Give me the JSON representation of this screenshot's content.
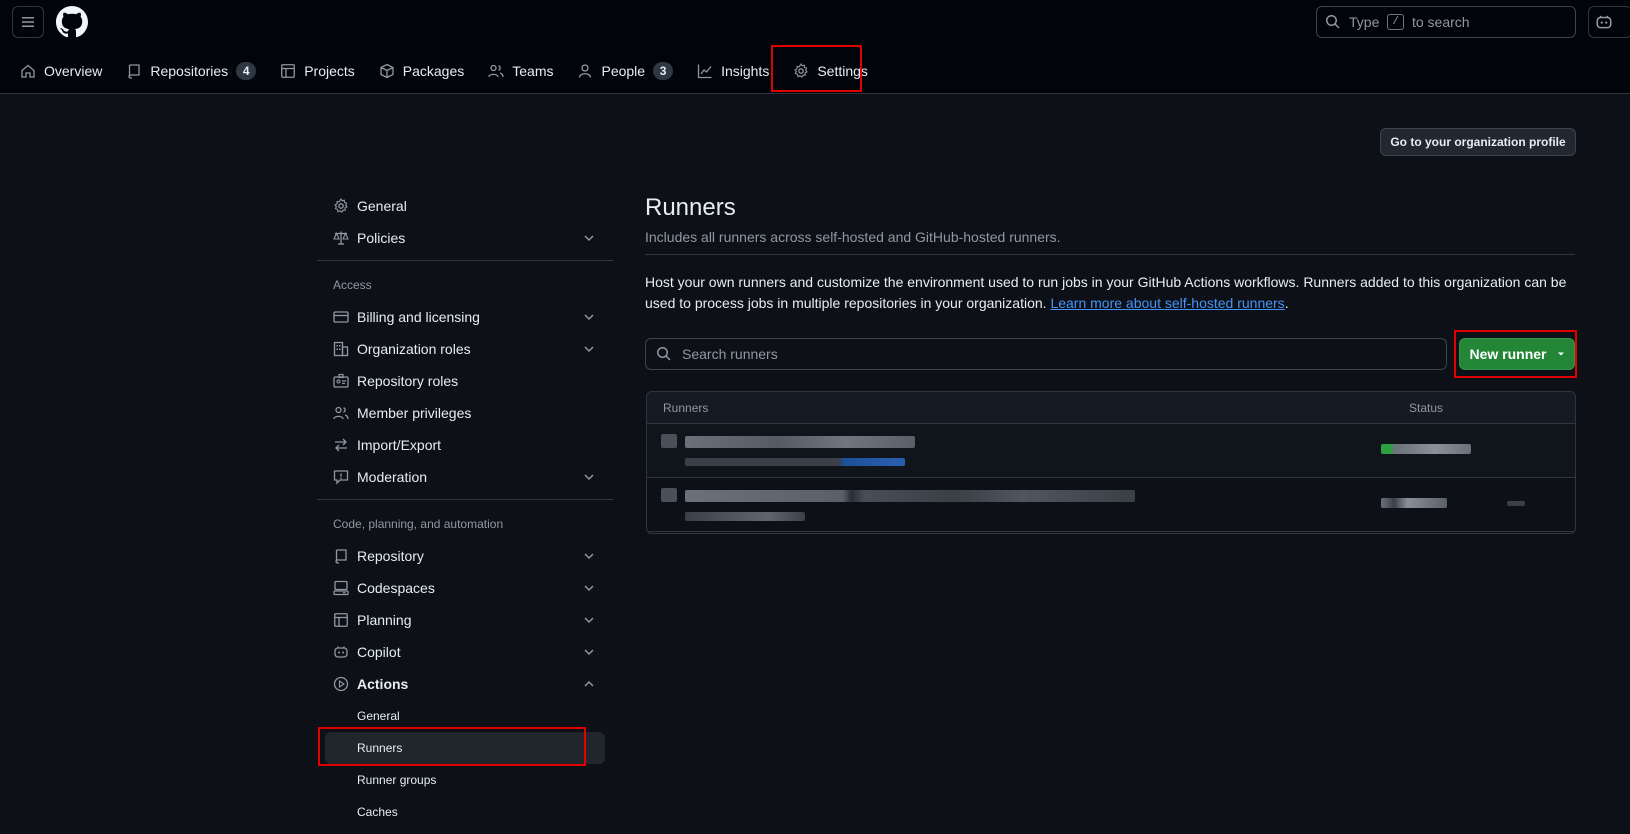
{
  "header": {
    "search_prefix": "Type",
    "search_key": "/",
    "search_suffix": "to search"
  },
  "orgnav": {
    "tabs": [
      {
        "label": "Overview"
      },
      {
        "label": "Repositories",
        "count": "4"
      },
      {
        "label": "Projects"
      },
      {
        "label": "Packages"
      },
      {
        "label": "Teams"
      },
      {
        "label": "People",
        "count": "3"
      },
      {
        "label": "Insights"
      },
      {
        "label": "Settings"
      }
    ]
  },
  "sidebar": {
    "top": [
      {
        "label": "General"
      },
      {
        "label": "Policies"
      }
    ],
    "access_heading": "Access",
    "access": [
      {
        "label": "Billing and licensing"
      },
      {
        "label": "Organization roles"
      },
      {
        "label": "Repository roles"
      },
      {
        "label": "Member privileges"
      },
      {
        "label": "Import/Export"
      },
      {
        "label": "Moderation"
      }
    ],
    "code_heading": "Code, planning, and automation",
    "code": [
      {
        "label": "Repository"
      },
      {
        "label": "Codespaces"
      },
      {
        "label": "Planning"
      },
      {
        "label": "Copilot"
      },
      {
        "label": "Actions"
      }
    ],
    "actions_sub": [
      {
        "label": "General"
      },
      {
        "label": "Runners"
      },
      {
        "label": "Runner groups"
      },
      {
        "label": "Caches"
      }
    ]
  },
  "main": {
    "profile_button": "Go to your organization profile",
    "title": "Runners",
    "subtitle": "Includes all runners across self-hosted and GitHub-hosted runners.",
    "description": "Host your own runners and customize the environment used to run jobs in your GitHub Actions workflows. Runners added to this organization can be used to process jobs in multiple repositories in your organization.",
    "learn_more": "Learn more about self-hosted runners",
    "search_placeholder": "Search runners",
    "new_runner": "New runner",
    "table": {
      "col_runners": "Runners",
      "col_status": "Status"
    }
  },
  "colors": {
    "accent_green": "#238636",
    "link": "#4493f8",
    "highlight_box": "#e00000"
  }
}
